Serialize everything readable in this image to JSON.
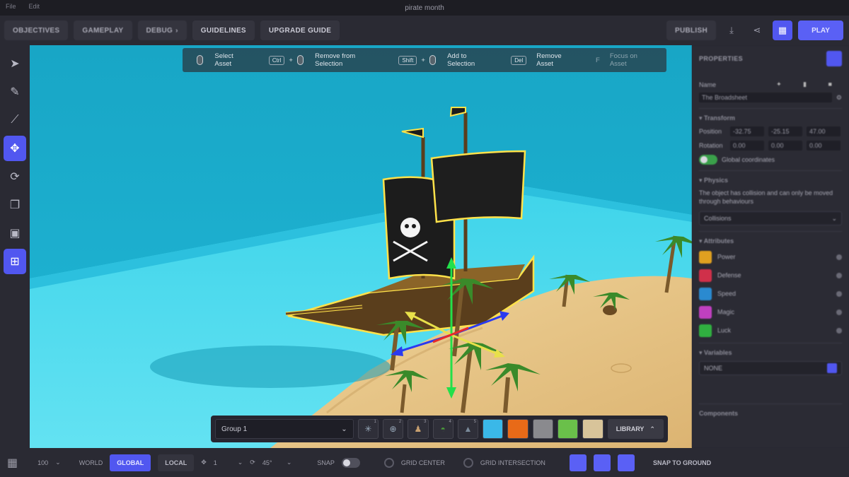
{
  "window": {
    "title": "pirate month",
    "menu": [
      "File",
      "Edit"
    ]
  },
  "topnav": {
    "buttons": [
      "OBJECTIVES",
      "GAMEPLAY",
      "DEBUG",
      "GUIDELINES",
      "UPGRADE GUIDE"
    ],
    "debug_chevron": "›",
    "publish": "PUBLISH",
    "play": "PLAY"
  },
  "hints": [
    {
      "key": "",
      "label": "Select Asset"
    },
    {
      "key": "Ctrl",
      "label": "Remove from Selection"
    },
    {
      "key": "Shift",
      "label": "Add to Selection"
    },
    {
      "key": "Del",
      "label": "Remove Asset"
    },
    {
      "key": "F",
      "label": "Focus on Asset"
    }
  ],
  "assetbar": {
    "group": "Group 1",
    "slots": [
      "1",
      "2",
      "3",
      "4",
      "5"
    ],
    "library": "LIBRARY"
  },
  "bottombar": {
    "grid_label": "100",
    "world": "WORLD",
    "global": "GLOBAL",
    "local": "LOCAL",
    "step": "1",
    "angle": "45°",
    "snap": "SNAP",
    "grid_center": "GRID CENTER",
    "grid_intersection": "GRID INTERSECTION",
    "snap_to_ground": "SNAP TO GROUND"
  },
  "panel": {
    "title": "PROPERTIES",
    "name_label": "Name",
    "name_value": "The Broadsheet",
    "transform": "Transform",
    "position_label": "Position",
    "position": [
      "-32.75",
      "-25.15",
      "47.00"
    ],
    "rotation_label": "Rotation",
    "rotation": [
      "0.00",
      "0.00",
      "0.00"
    ],
    "global_coords": "Global coordinates",
    "physics": "Physics",
    "physics_desc": "The object has collision and can only be moved through behaviours",
    "collisions": "Collisions",
    "attributes": "Attributes",
    "attribute_list": [
      {
        "name": "Power",
        "color": "#e0a020"
      },
      {
        "name": "Defense",
        "color": "#d0304a"
      },
      {
        "name": "Speed",
        "color": "#2a8ad0"
      },
      {
        "name": "Magic",
        "color": "#c040c0"
      },
      {
        "name": "Luck",
        "color": "#30b040"
      }
    ],
    "variables": "Variables",
    "variable_value": "NONE",
    "components": "Components"
  },
  "colors": {
    "accent": "#5157f0",
    "sea": "#1da8c8",
    "sand": "#e6c48a"
  }
}
